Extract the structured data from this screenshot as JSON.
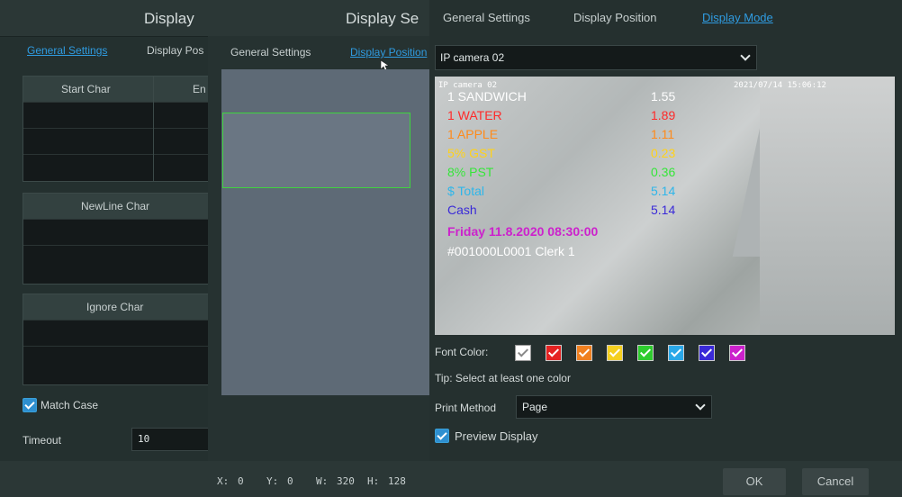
{
  "panel1": {
    "title": "Display",
    "tabs": [
      "General Settings",
      "Display Pos"
    ],
    "tables": [
      {
        "col1": "Start Char",
        "col2": "En"
      },
      {
        "col1": "NewLine Char"
      },
      {
        "col1": "Ignore Char"
      }
    ],
    "match_case": "Match Case",
    "timeout_label": "Timeout",
    "timeout_value": "10"
  },
  "panel2": {
    "title": "Display Se",
    "tabs": [
      "General Settings",
      "Display Position"
    ],
    "coords": {
      "x_label": "X:",
      "x": "0",
      "y_label": "Y:",
      "y": "0",
      "w_label": "W:",
      "w": "320",
      "h_label": "H:",
      "h": "128"
    }
  },
  "panel3": {
    "tabs": [
      "General Settings",
      "Display Position",
      "Display Mode"
    ],
    "camera_select": "IP camera 02",
    "osd": {
      "cam_label": "IP camera 02",
      "timestamp": "2021/07/14 15:06:12",
      "lines": [
        {
          "item": "1 SANDWICH",
          "price": "1.55",
          "color": "#ffffff"
        },
        {
          "item": "1 WATER",
          "price": "1.89",
          "color": "#ff2a2a"
        },
        {
          "item": "1 APPLE",
          "price": "1.11",
          "color": "#ff8a1a"
        },
        {
          "item": "5% GST",
          "price": "0.23",
          "color": "#ffd21a"
        },
        {
          "item": "8% PST",
          "price": "0.36",
          "color": "#36e63a"
        },
        {
          "item": "$ Total",
          "price": "5.14",
          "color": "#2eb6ea"
        },
        {
          "item": "Cash",
          "price": "5.14",
          "color": "#3a2ad8"
        }
      ],
      "date_line": "Friday   11.8.2020    08:30:00",
      "clerk_line": "#001000L0001 Clerk 1"
    },
    "font_color_label": "Font Color:",
    "swatch_colors": [
      "#ffffff",
      "#e52222",
      "#f08020",
      "#f5d020",
      "#2ecc2e",
      "#2aa8e8",
      "#3a2ad8",
      "#cc22cc"
    ],
    "tip": "Tip: Select at least one color",
    "print_method_label": "Print Method",
    "print_method_value": "Page",
    "preview_display": "Preview Display",
    "ok": "OK",
    "cancel": "Cancel"
  }
}
